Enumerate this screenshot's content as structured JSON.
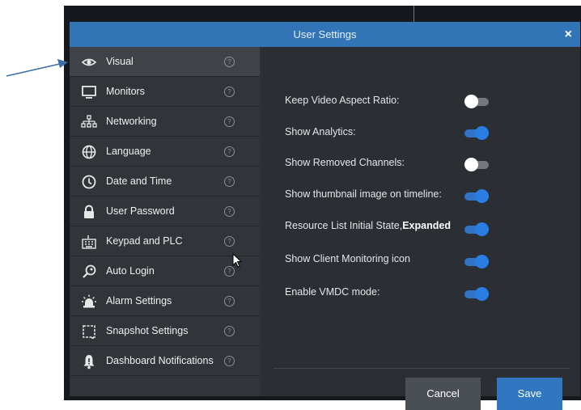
{
  "dialog": {
    "title": "User Settings",
    "close_glyph": "×"
  },
  "sidebar": {
    "help_glyph": "?",
    "items": [
      {
        "label": "Visual",
        "icon": "eye-icon",
        "active": true
      },
      {
        "label": "Monitors",
        "icon": "monitor-icon"
      },
      {
        "label": "Networking",
        "icon": "network-icon"
      },
      {
        "label": "Language",
        "icon": "globe-icon"
      },
      {
        "label": "Date and Time",
        "icon": "clock-icon"
      },
      {
        "label": "User Password",
        "icon": "lock-icon"
      },
      {
        "label": "Keypad and PLC",
        "icon": "keypad-icon"
      },
      {
        "label": "Auto Login",
        "icon": "key-icon"
      },
      {
        "label": "Alarm Settings",
        "icon": "alarm-light-icon"
      },
      {
        "label": "Snapshot Settings",
        "icon": "snapshot-icon"
      },
      {
        "label": "Dashboard Notifications",
        "icon": "bell-icon"
      }
    ]
  },
  "settings": {
    "keep_aspect": {
      "label": "Keep Video Aspect Ratio:",
      "on": false
    },
    "show_analytics": {
      "label": "Show Analytics:",
      "on": true
    },
    "show_removed": {
      "label": "Show Removed Channels:",
      "on": false
    },
    "show_thumbnail": {
      "label": "Show thumbnail image on timeline:",
      "on": true
    },
    "resource_list": {
      "label": "Resource List Initial State,",
      "label_bold": "Expanded",
      "on": true
    },
    "client_monitoring": {
      "label": "Show Client Monitoring icon",
      "on": true
    },
    "vmdc_mode": {
      "label": "Enable VMDC mode:",
      "on": true
    }
  },
  "footer": {
    "cancel_label": "Cancel",
    "save_label": "Save"
  },
  "colors": {
    "titlebar": "#3175b6",
    "toggle_on": "#2a7de3",
    "save_button": "#3077c0",
    "annotation_arrow": "#3d6fa8"
  }
}
